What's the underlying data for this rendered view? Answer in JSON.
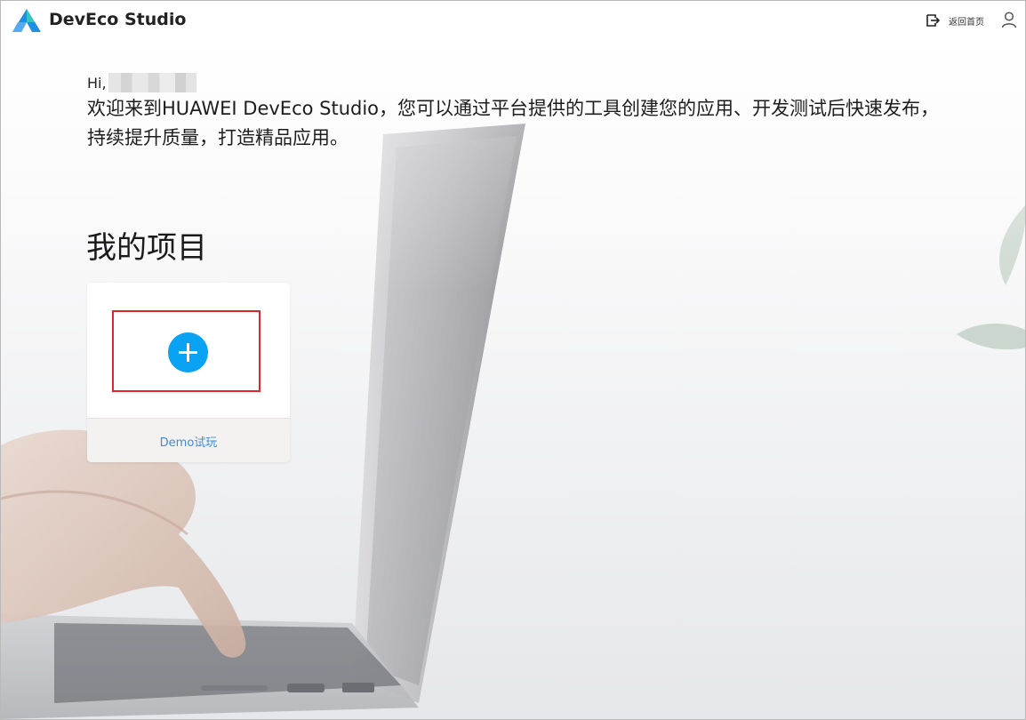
{
  "app": {
    "title": "DevEco Studio"
  },
  "header": {
    "home_label": "返回首页",
    "icons": {
      "exit": "exit-to-home-icon",
      "user": "user-icon"
    }
  },
  "welcome": {
    "greeting": "Hi,",
    "line1": "欢迎来到HUAWEI DevEco Studio，您可以通过平台提供的工具创建您的应用、开发测试后快速发布，",
    "line2": "持续提升质量，打造精品应用。"
  },
  "projects": {
    "section_title": "我的项目",
    "create_card": {
      "demo_label": "Demo试玩"
    }
  },
  "colors": {
    "accent": "#0aa2f2",
    "link": "#3f8bd6",
    "highlight": "#e0262b",
    "logo_blue": "#1f8fe6",
    "logo_teal": "#37c6c4"
  }
}
